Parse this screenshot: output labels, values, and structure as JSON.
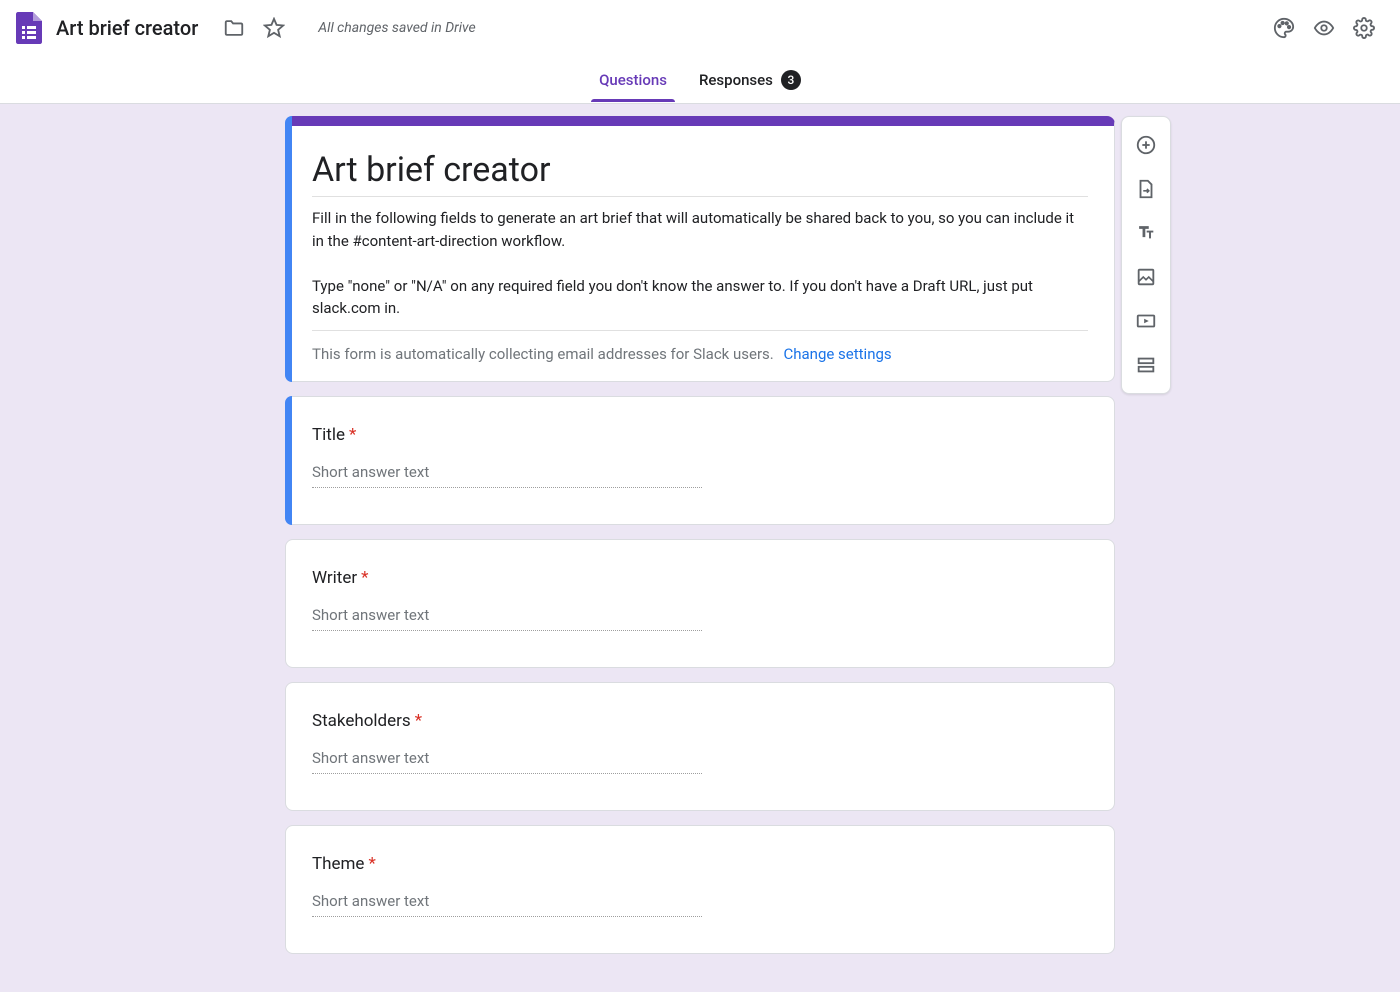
{
  "header": {
    "title": "Art brief creator",
    "saved_text": "All changes saved in Drive"
  },
  "tabs": {
    "questions": "Questions",
    "responses": "Responses",
    "response_count": "3"
  },
  "form": {
    "title": "Art brief creator",
    "description": "Fill in the following fields to generate an art brief that will automatically be shared back to you, so you can include it in the #content-art-direction workflow.\n\nType \"none\" or \"N/A\" on any required field you don't know the answer to. If you don't have a Draft URL, just put slack.com in.",
    "email_notice": "This form is automatically collecting email addresses for Slack users.",
    "change_settings": "Change settings"
  },
  "questions": [
    {
      "label": "Title",
      "required": true,
      "placeholder": "Short answer text",
      "selected": true
    },
    {
      "label": "Writer",
      "required": true,
      "placeholder": "Short answer text",
      "selected": false
    },
    {
      "label": "Stakeholders",
      "required": true,
      "placeholder": "Short answer text",
      "selected": false
    },
    {
      "label": "Theme",
      "required": true,
      "placeholder": "Short answer text",
      "selected": false
    }
  ]
}
